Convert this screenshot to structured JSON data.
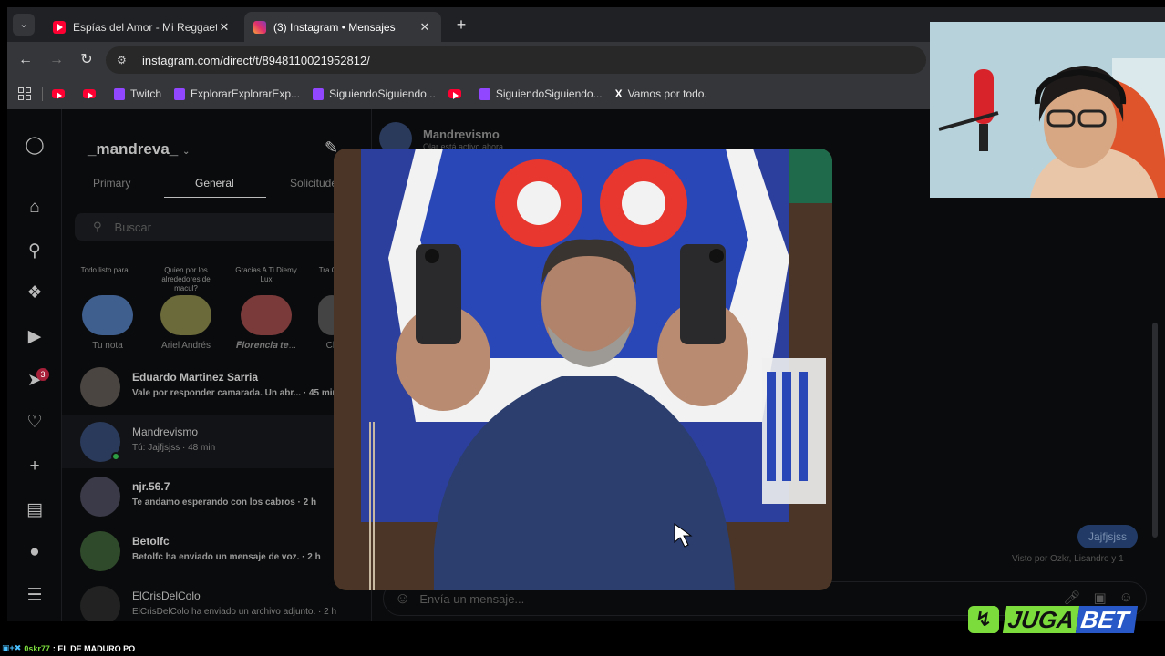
{
  "browser": {
    "tabs": [
      {
        "title": "Espías del Amor - Mi Reggaetón",
        "favicon": "youtube-icon",
        "active": false
      },
      {
        "title": "(3) Instagram • Mensajes",
        "favicon": "instagram-icon",
        "active": true
      }
    ],
    "url": "instagram.com/direct/t/8948110021952812/",
    "bookmarks": [
      {
        "label": "",
        "icon": "youtube-icon"
      },
      {
        "label": "",
        "icon": "youtube-icon"
      },
      {
        "label": "Twitch",
        "icon": "twitch-icon"
      },
      {
        "label": "ExplorarExplorarExp...",
        "icon": "twitch-icon"
      },
      {
        "label": "SiguiendoSiguiendo...",
        "icon": "twitch-icon"
      },
      {
        "label": "",
        "icon": "youtube-icon"
      },
      {
        "label": "SiguiendoSiguiendo...",
        "icon": "twitch-icon"
      },
      {
        "label": "Vamos por todo.",
        "icon": "x-icon"
      }
    ]
  },
  "inbox": {
    "username": "_mandreva_",
    "tabs": [
      "Primary",
      "General",
      "Solicitudes"
    ],
    "selected_tab": "General",
    "search_placeholder": "Buscar",
    "notes": [
      {
        "bubble": "Todo listo para...",
        "name": "Tu nota"
      },
      {
        "bubble": "Quien por los alrededores de macul?",
        "name": "Ariel Andrés"
      },
      {
        "bubble": "Gracias A Ti Diemy Lux",
        "name": "𝑭𝒍𝒐𝒓𝒆𝒏𝒄𝒊𝒂 𝒕𝒆..."
      },
      {
        "bubble": "Tra Cua",
        "name": "Ch"
      }
    ],
    "threads": [
      {
        "name": "Eduardo Martinez Sarria",
        "message": "Vale por responder camarada. Un abr... · 45 min",
        "unread": true
      },
      {
        "name": "Mandrevismo",
        "message": "Tú: Jajfjsjss · 48 min",
        "unread": false,
        "selected": true
      },
      {
        "name": "njr.56.7",
        "message": "Te andamo esperando con los cabros · 2 h",
        "unread": true
      },
      {
        "name": "Betolfc",
        "message": "Betolfc ha enviado un mensaje de voz. · 2 h",
        "unread": true
      },
      {
        "name": "ElCrisDelColo",
        "message": "ElCrisDelColo ha enviado un archivo adjunto. · 2 h",
        "unread": false
      }
    ],
    "rail_badge": "3"
  },
  "chat": {
    "name": "Mandrevismo",
    "status": "Olar está activo ahora",
    "last_sent": "Jajfjsjss",
    "seen_by": "Visto por Ozkr, Lisandro y 1",
    "composer_placeholder": "Envía un mensaje..."
  },
  "overlay": {
    "sponsor_part1": "JUGA",
    "sponsor_part2": "BET",
    "chat_user": "0skr77",
    "chat_message": ": EL DE MADURO PO"
  }
}
